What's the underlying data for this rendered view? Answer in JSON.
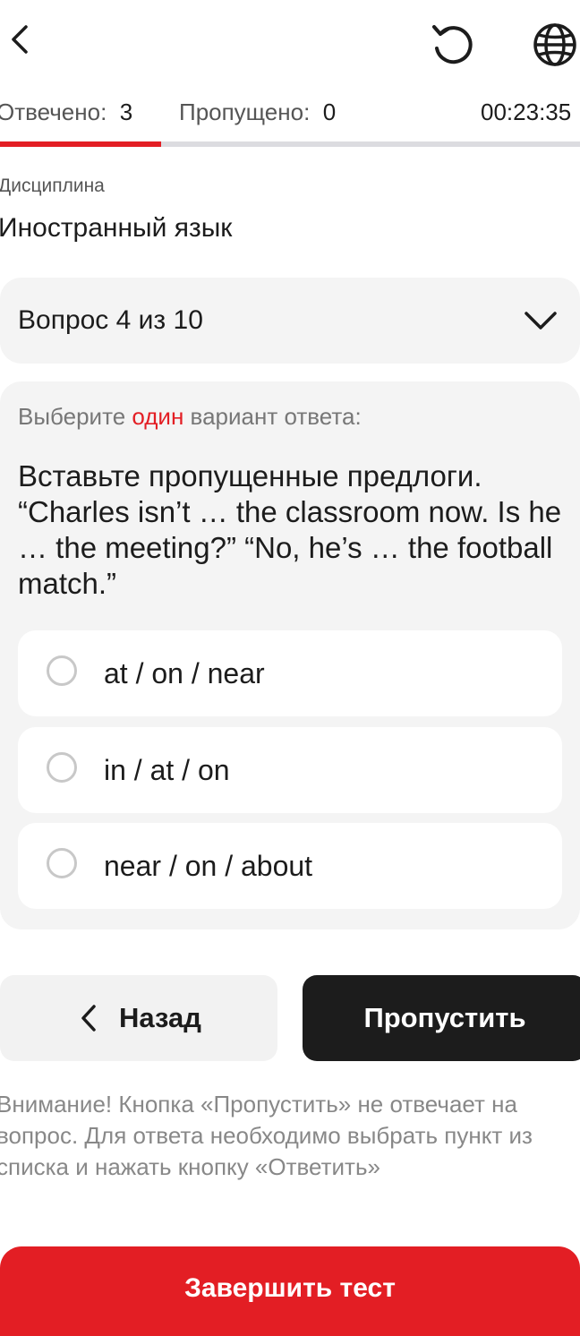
{
  "header": {
    "back_icon": "chevron-left-icon",
    "reset_icon": "rotate-ccw-icon",
    "language_icon": "globe-icon"
  },
  "stats": {
    "answered_label": "Отвечено:",
    "answered_value": "3",
    "skipped_label": "Пропущено:",
    "skipped_value": "0",
    "timer": "00:23:35",
    "progress": 0.3
  },
  "discipline": {
    "label": "Дисциплина",
    "value": "Иностранный язык"
  },
  "question_selector": {
    "label": "Вопрос 4 из 10",
    "icon": "chevron-down-icon"
  },
  "question": {
    "instruction_prefix": "Выберите ",
    "instruction_highlight": "один",
    "instruction_suffix": " вариант ответа:",
    "text": "Вставьте пропущенные предлоги. “Charles isn’t … the classroom now. Is he … the meeting?” “No, he’s … the football match.”",
    "options": [
      {
        "label": "at / on / near"
      },
      {
        "label": "in / at / on"
      },
      {
        "label": "near / on / about"
      }
    ]
  },
  "buttons": {
    "back_label": "Назад",
    "skip_label": "Пропустить",
    "finish_label": "Завершить тест"
  },
  "notice": "Внимание! Кнопка «Пропустить» не отвечает на вопрос. Для ответа необходимо выбрать пункт из списка и нажать кнопку «Ответить»",
  "colors": {
    "accent": "#e31e24",
    "dark_button": "#1c1c1c",
    "card_bg": "#f4f4f4"
  }
}
